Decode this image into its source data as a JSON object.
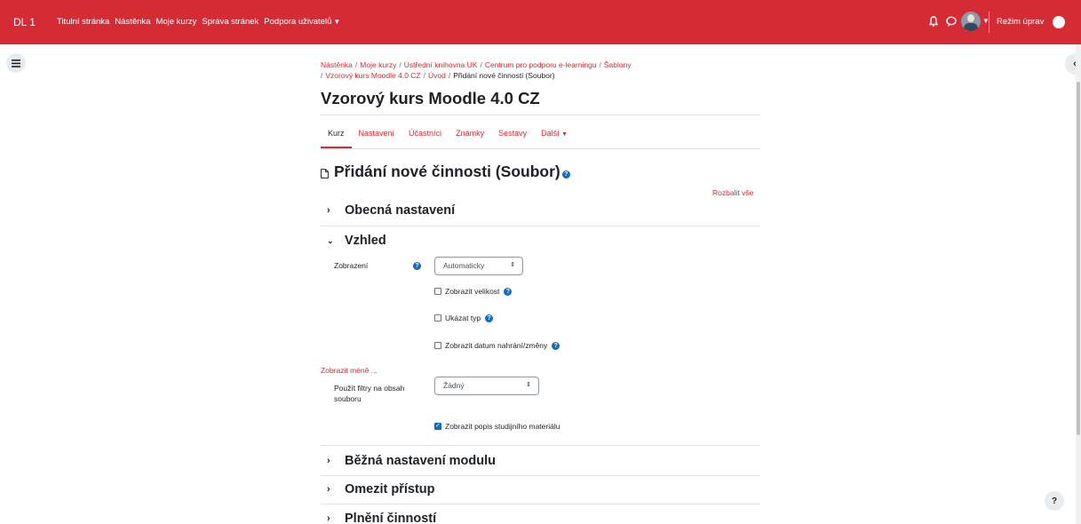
{
  "navbar": {
    "brand": "DL 1",
    "links": [
      {
        "label": "Titulní stránka"
      },
      {
        "label": "Nástěnka"
      },
      {
        "label": "Moje kurzy"
      },
      {
        "label": "Správa stránek"
      },
      {
        "label": "Podpora uživatelů",
        "dropdown": true
      }
    ],
    "edit_mode_label": "Režim úprav",
    "icons": [
      "bell-icon",
      "chat-icon",
      "avatar",
      "toggle-switch"
    ],
    "color": "#d52b35"
  },
  "breadcrumb": {
    "items": [
      "Nástěnka",
      "Moje kurzy",
      "Ústřední knihovna UK",
      "Centrum pro podporu e-learningu",
      "Šablony",
      "Vzorový kurs Moodle 4.0 CZ",
      "Úvod",
      "Přidání nové činnosti (Soubor)"
    ]
  },
  "course_title": "Vzorový kurs Moodle 4.0 CZ",
  "tabs": [
    {
      "label": "Kurz",
      "active": true
    },
    {
      "label": "Nastavení"
    },
    {
      "label": "Účastníci"
    },
    {
      "label": "Známky"
    },
    {
      "label": "Sestavy"
    },
    {
      "label": "Další",
      "dropdown": true
    }
  ],
  "activity_title": "Přidání nové činnosti (Soubor)",
  "expand_all": "Rozbalit vše",
  "sections": {
    "general": "Obecná nastavení",
    "appearance": "Vzhled",
    "common": "Běžná nastavení modulu",
    "restrict": "Omezit přístup",
    "completion": "Plnění činností"
  },
  "appearance": {
    "display_label": "Zobrazení",
    "display_value": "Automaticky",
    "checkboxes": [
      {
        "label": "Zobrazit velikost",
        "checked": false
      },
      {
        "label": "Ukázat typ",
        "checked": false
      },
      {
        "label": "Zobrazit datum nahrání/změny",
        "checked": false
      }
    ],
    "show_less": "Zobrazit méně ...",
    "filters_label": "Použít filtry na obsah souboru",
    "filters_value": "Žádný",
    "show_description": {
      "label": "Zobrazit popis studijního materiálu",
      "checked": true
    }
  },
  "help_button": "?"
}
